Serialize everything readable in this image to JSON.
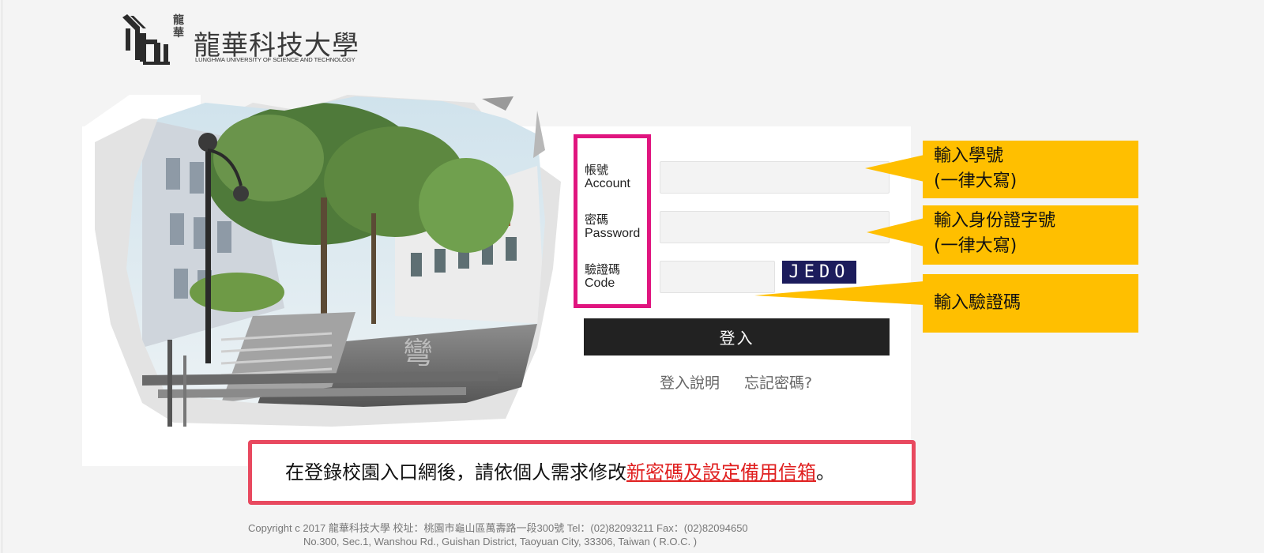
{
  "logo": {
    "calligraphy": "龍華",
    "name_zh": "龍華科技大學",
    "name_en": "LUNGHWA UNIVERSITY OF SCIENCE AND TECHNOLOGY"
  },
  "form": {
    "account": {
      "label_zh": "帳號",
      "label_en": "Account",
      "value": ""
    },
    "password": {
      "label_zh": "密碼",
      "label_en": "Password",
      "value": ""
    },
    "code": {
      "label_zh": "驗證碼",
      "label_en": "Code",
      "value": "",
      "captcha_text": "JEDO"
    },
    "login_label": "登入",
    "help_link": "登入說明",
    "forgot_link": "忘記密碼?"
  },
  "callouts": {
    "account_line1": "輸入學號",
    "account_line2": "(一律大寫)",
    "password_line1": "輸入身份證字號",
    "password_line2": "(一律大寫)",
    "code_line1": "輸入驗證碼"
  },
  "notice": {
    "text_before": "在登錄校園入口網後，請依個人需求修改",
    "text_highlight": "新密碼及設定備用信箱",
    "text_after": "。"
  },
  "footer": {
    "line1": "Copyright c 2017 龍華科技大學 校址：桃園市龜山區萬壽路一段300號 Tel：(02)82093211    Fax：(02)82094650",
    "line2": "No.300, Sec.1, Wanshou Rd., Guishan District, Taoyuan City, 33306, Taiwan ( R.O.C. )"
  },
  "colors": {
    "highlight_border": "#e0157f",
    "callout": "#ffbf00",
    "notice_border": "#e8495f",
    "notice_highlight": "#e02020",
    "button": "#222222",
    "captcha_bg": "#1c1c5c"
  },
  "icons": {
    "logo_mark": "lunghwa-logo-icon",
    "photo": "campus-photo"
  }
}
